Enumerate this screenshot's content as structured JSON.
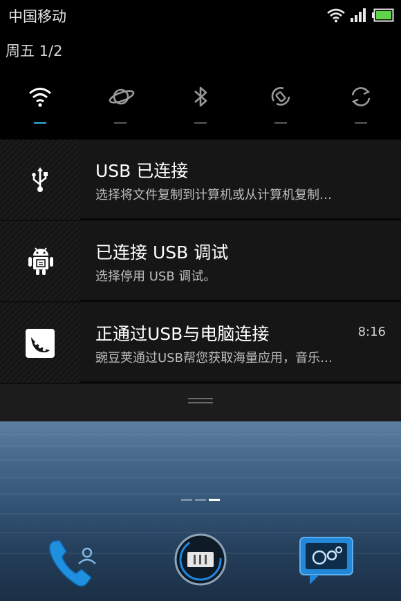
{
  "status_bar": {
    "carrier": "中国移动",
    "icons": [
      "wifi-icon",
      "signal-icon",
      "battery-icon"
    ],
    "battery_color": "#5fd34a"
  },
  "shade": {
    "date": "周五 1/2",
    "toggles": [
      {
        "name": "wifi",
        "icon": "wifi-icon",
        "active": true
      },
      {
        "name": "gprs",
        "icon": "data-orbit-icon",
        "active": false
      },
      {
        "name": "bluetooth",
        "icon": "bluetooth-icon",
        "active": false
      },
      {
        "name": "auto-rotate",
        "icon": "rotate-icon",
        "active": false
      },
      {
        "name": "sync",
        "icon": "sync-icon",
        "active": false
      }
    ],
    "active_color": "#33b5e5"
  },
  "notifications": [
    {
      "icon": "usb-icon",
      "title": "USB 已连接",
      "subtitle": "选择将文件复制到计算机或从计算机复制…",
      "time": ""
    },
    {
      "icon": "android-debug-icon",
      "title": "已连接 USB 调试",
      "subtitle": "选择停用 USB 调试。",
      "time": ""
    },
    {
      "icon": "wandoujia-icon",
      "title": "正通过USB与电脑连接",
      "subtitle": "豌豆荚通过USB帮您获取海量应用，音乐…",
      "time": "8:16"
    }
  ],
  "home": {
    "page_count": 3,
    "current_page": 3,
    "dock": [
      {
        "name": "phone",
        "icon": "phone-contacts-icon"
      },
      {
        "name": "apps",
        "icon": "app-drawer-icon"
      },
      {
        "name": "messaging",
        "icon": "message-bubble-icon"
      }
    ]
  }
}
